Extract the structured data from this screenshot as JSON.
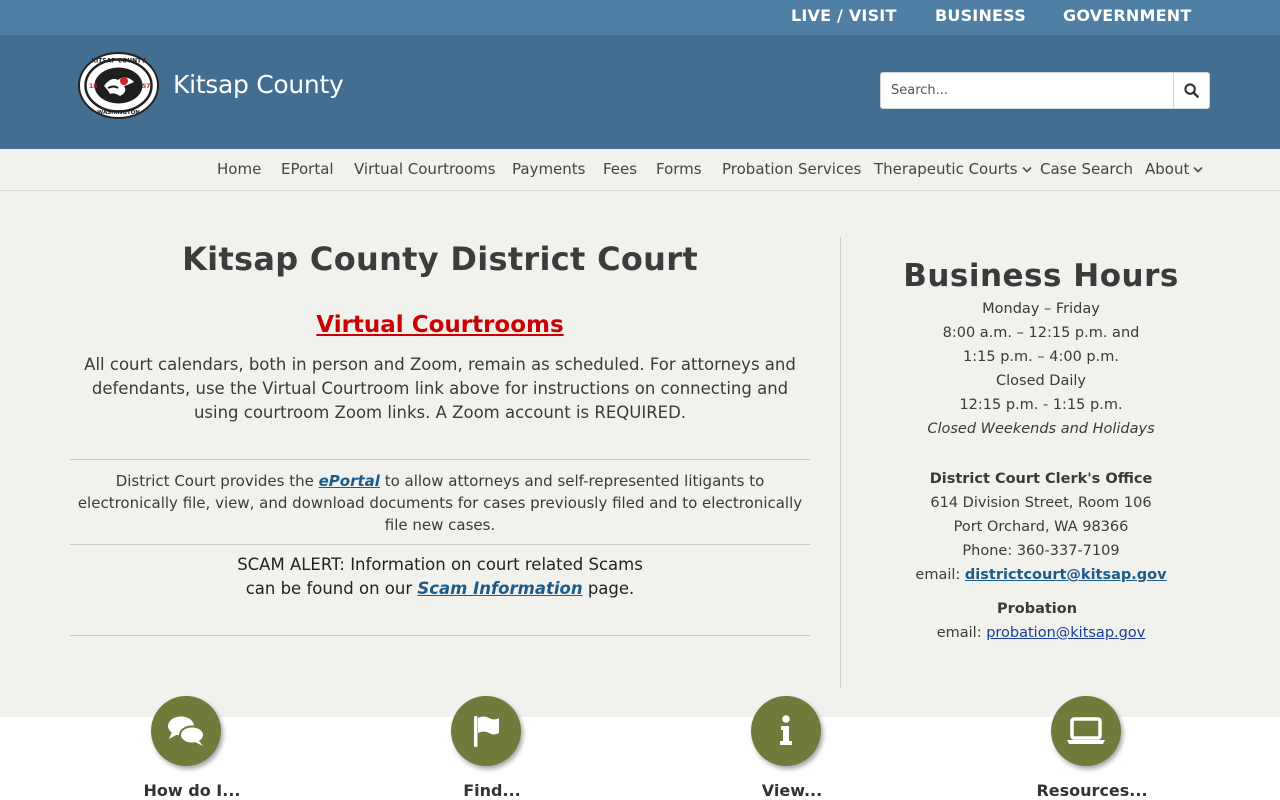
{
  "top_links": [
    "LIVE / VISIT",
    "BUSINESS",
    "GOVERNMENT"
  ],
  "header": {
    "brand": "Kitsap County",
    "search_placeholder": "Search...",
    "seal_text_top": "KITSAP COUNTY",
    "seal_text_bottom": "WASHINGTON",
    "seal_year_left": "18",
    "seal_year_right": "57"
  },
  "nav": [
    {
      "label": "Home"
    },
    {
      "label": "EPortal"
    },
    {
      "label": "Virtual Courtrooms"
    },
    {
      "label": "Payments"
    },
    {
      "label": "Fees"
    },
    {
      "label": "Forms"
    },
    {
      "label": "Probation Services"
    },
    {
      "label": "Therapeutic Courts",
      "dropdown": true
    },
    {
      "label": "Case Search"
    },
    {
      "label": "About",
      "dropdown": true
    }
  ],
  "main": {
    "title": "Kitsap County District Court",
    "virtual_link": "Virtual Courtrooms",
    "para1": "All court calendars, both in person and Zoom, remain as scheduled.  For attorneys and defendants, use the Virtual Courtroom link above for instructions on connecting and using courtroom Zoom links. A Zoom account is REQUIRED.",
    "para2_pre": "District Court provides the ",
    "para2_link": "ePortal",
    "para2_post": " to allow attorneys and self-represented litigants to electronically file, view, and download  documents for cases previously filed and to electronically file new cases.",
    "scam_line1": "SCAM ALERT: Information on court related Scams",
    "scam_line2_pre": "can be found on our ",
    "scam_link": "Scam Information",
    "scam_line2_post": " page."
  },
  "sidebar": {
    "title": "Business Hours",
    "hours": [
      "Monday – Friday",
      "8:00 a.m. – 12:15 p.m. and",
      "1:15 p.m. – 4:00 p.m.",
      "Closed Daily",
      "12:15 p.m. - 1:15 p.m."
    ],
    "closed": "Closed Weekends and Holidays",
    "office_title": "District Court Clerk's Office",
    "address1": "614 Division Street, Room 106",
    "address2": "Port Orchard, WA 98366",
    "phone": "Phone: 360-337-7109",
    "email_label": "email: ",
    "email": "districtcourt@kitsap.gov",
    "probation_title": "Probation",
    "probation_email_label": "email:  ",
    "probation_email": "probation@kitsap.gov"
  },
  "bottom": [
    {
      "label": "How do I...",
      "icon": "chat-icon"
    },
    {
      "label": "Find...",
      "icon": "flag-icon"
    },
    {
      "label": "View...",
      "icon": "info-icon"
    },
    {
      "label": "Resources...",
      "icon": "laptop-icon"
    }
  ],
  "colors": {
    "top_bar": "#4f7fa3",
    "header": "#426f91",
    "accent_olive": "#6f7b3a",
    "link_red": "#cc0000",
    "link_blue": "#1d5b8a"
  }
}
